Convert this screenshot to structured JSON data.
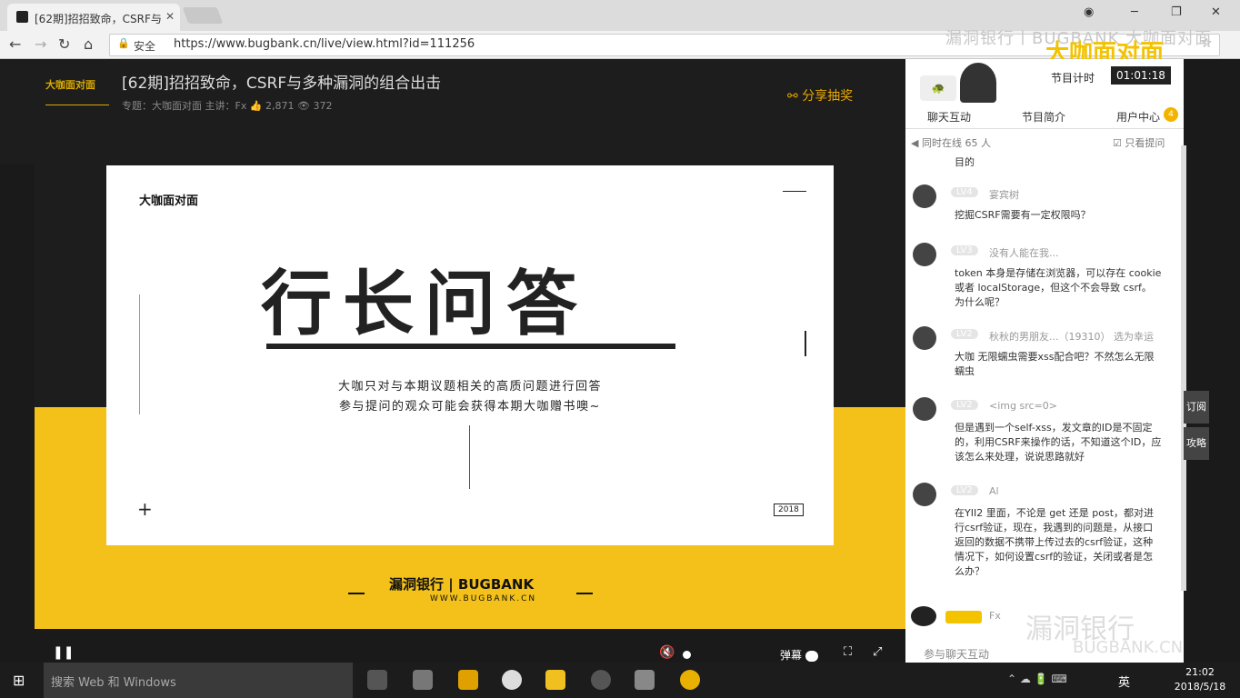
{
  "browser": {
    "tab_title": "[62期]招招致命，CSRF与",
    "tab_close": "✕",
    "secure_label": "安全",
    "url": "https://www.bugbank.cn/live/view.html?id=111256",
    "watermark_top": "漏洞银行丨BUGBANK 大咖面对面",
    "watermark_brand": "大咖面对面"
  },
  "live": {
    "logo_text": "大咖面对面",
    "title": "[62期]招招致命，CSRF与多种漏洞的组合出击",
    "meta": "专题：大咖面对面   主讲：Fx   👍 2,871   👁 372",
    "share_label": "分享抽奖"
  },
  "slide": {
    "brand": "大咖面对面",
    "heading": "行长问答",
    "line1": "大咖只对与本期议题相关的高质问题进行回答",
    "line2": "参与提问的观众可能会获得本期大咖赠书噢~",
    "year": "2018",
    "footer_brand": "漏洞银行 | BUGBANK",
    "footer_url": "WWW.BUGBANK.CN"
  },
  "player": {
    "pause_icon": "❚❚",
    "mute_icon": "🔇",
    "danmu_label": "弹幕"
  },
  "sidebar": {
    "timer_label": "节目计时",
    "timer": "01:01:18",
    "tabs": [
      "聊天互动",
      "节目简介",
      "用户中心"
    ],
    "user_badge": "4",
    "online": "◀ 同时在线 65 人",
    "only_questions": "☑ 只看提问",
    "messages": [
      {
        "level": "",
        "name": "",
        "text": "目的"
      },
      {
        "level": "LV4",
        "name": "宴宾树",
        "text": "挖掘CSRF需要有一定权限吗？"
      },
      {
        "level": "LV3",
        "name": "没有人能在我...",
        "text": "token 本身是存储在浏览器，可以存在 cookie 或者 localStorage，但这个不会导致 csrf。 为什么呢？"
      },
      {
        "level": "LV2",
        "name": "秋秋的男朋友...（19310）  选为幸运",
        "text": "大咖 无限蠕虫需要xss配合吧？不然怎么无限蠕虫"
      },
      {
        "level": "LV2",
        "name": "<img src=0>",
        "text": "但是遇到一个self-xss，发文章的ID是不固定的，利用CSRF来操作的话，不知道这个ID，应该怎么来处理，说说思路就好"
      },
      {
        "level": "LV2",
        "name": "Al",
        "text": "在YII2 里面，不论是 get 还是 post，都对进行csrf验证，现在，我遇到的问题是，从接口返回的数据不携带上传过去的csrf验证，这种情况下，如何设置csrf的验证，关闭或者是怎么办？"
      }
    ],
    "gift_name": "Fx",
    "input_hint": "参与聊天互动",
    "watermark": "漏洞银行",
    "watermark_sub": "BUGBANK.CN",
    "float_subscribe": "订阅",
    "float_guide": "攻略"
  },
  "taskbar": {
    "search_placeholder": "搜索 Web 和 Windows",
    "lang": "英",
    "time": "21:02",
    "date": "2018/5/18"
  }
}
